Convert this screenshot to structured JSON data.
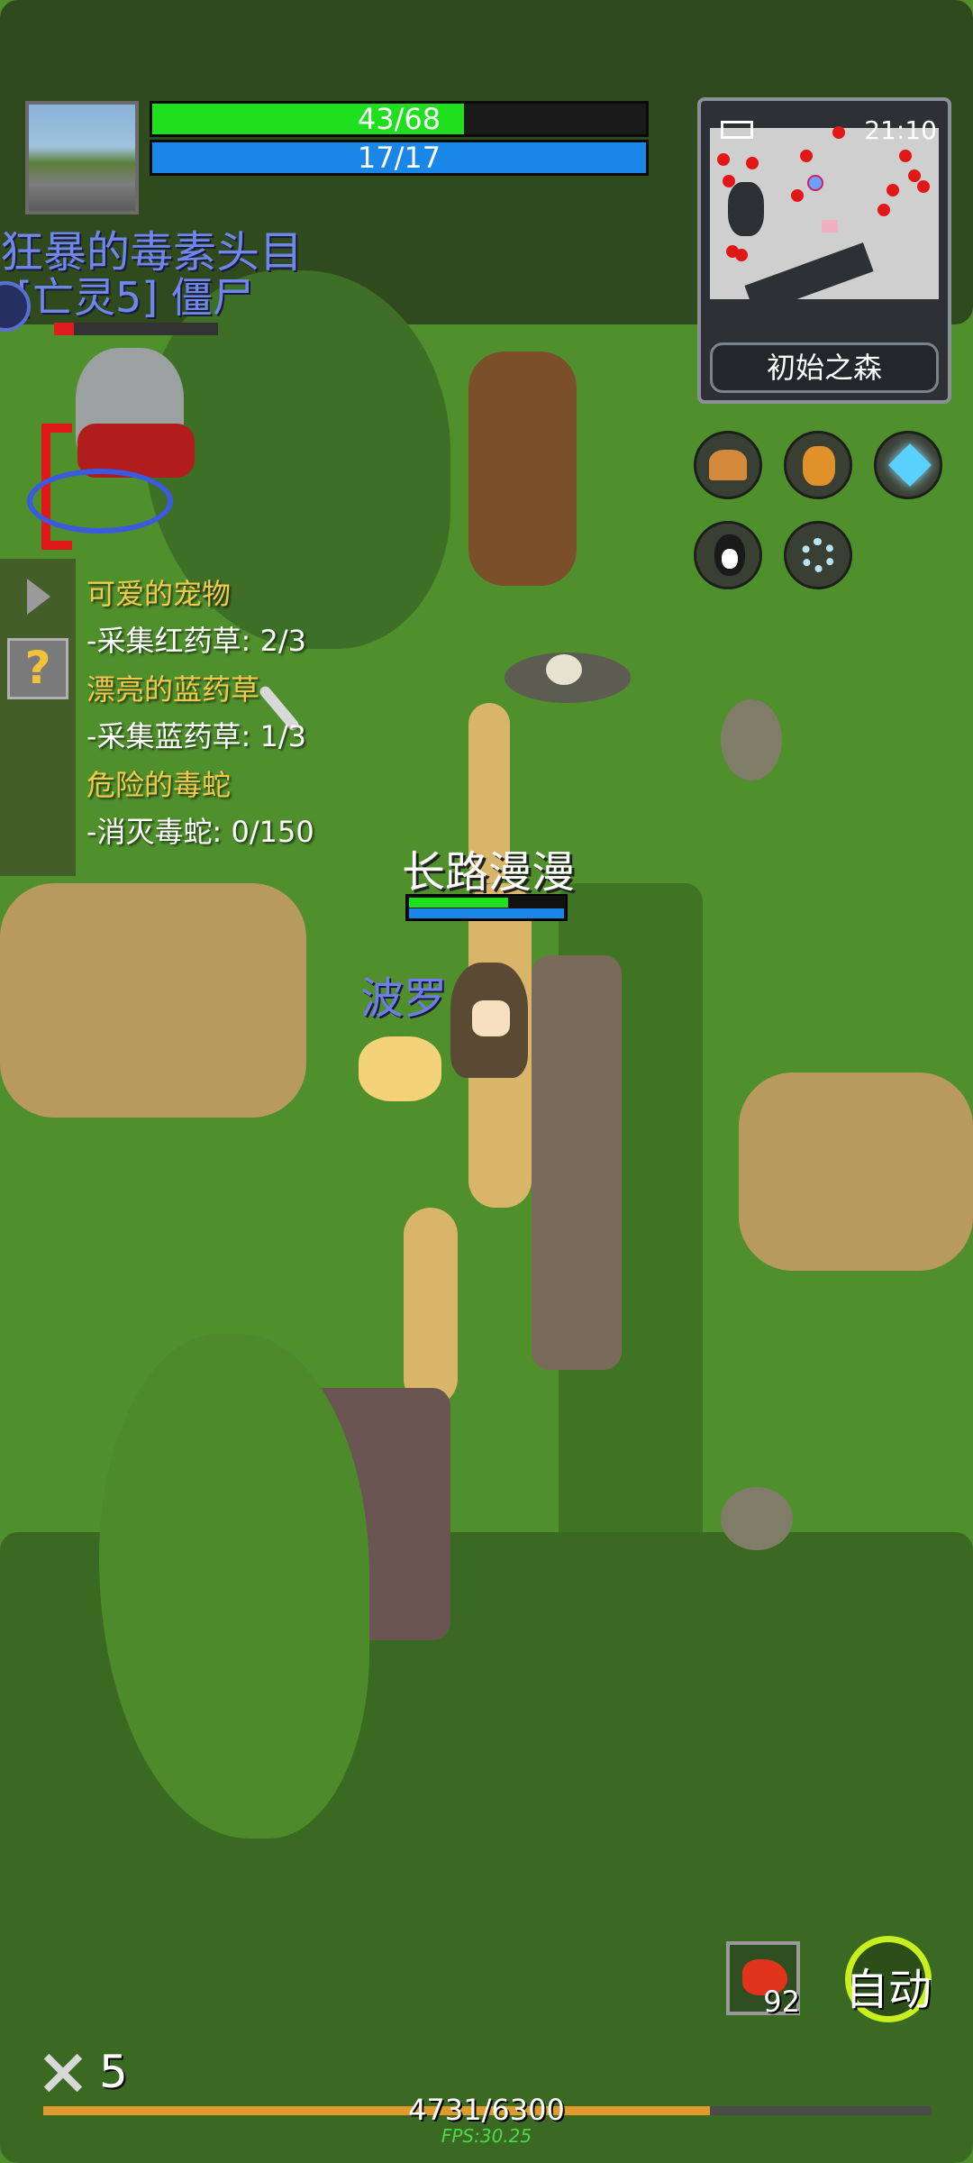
{
  "hud": {
    "hp_text": "43/68",
    "hp_fraction": 0.632,
    "mp_text": "17/17",
    "mp_fraction": 1.0,
    "hp_color": "#1fe01f",
    "mp_color": "#1a86e8"
  },
  "minimap": {
    "clock": "21:10",
    "area_name": "初始之森"
  },
  "target": {
    "title": "狂暴的毒素头目",
    "subtitle": "[亡灵5] 僵尸",
    "hp_fraction": 0.12
  },
  "quests": [
    {
      "title": "可爱的宠物",
      "task": "-采集红药草: 2/3"
    },
    {
      "title": "漂亮的蓝药草",
      "task": "-采集蓝药草: 1/3"
    },
    {
      "title": "危险的毒蛇",
      "task": "-消灭毒蛇: 0/150"
    }
  ],
  "player": {
    "name": "长路漫漫",
    "pet_name": "波罗"
  },
  "quick_slot": {
    "count": "92"
  },
  "auto_button": {
    "label": "自动"
  },
  "footer": {
    "level": "5",
    "xp_text": "4731/6300",
    "xp_fraction": 0.751,
    "fps": "FPS:30.25"
  },
  "menu_icons": [
    "helmet-icon",
    "potion-bag-icon",
    "crystal-icon",
    "penguin-icon",
    "gear-icon"
  ]
}
